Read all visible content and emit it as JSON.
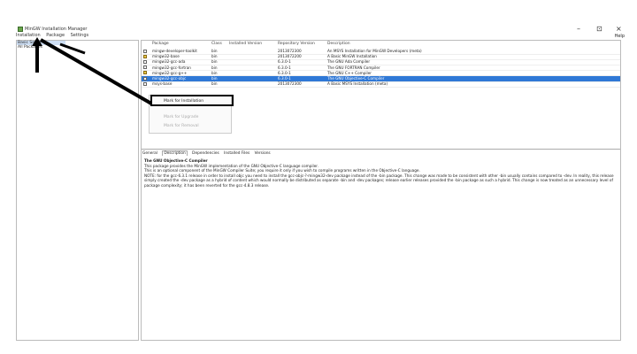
{
  "window": {
    "title": "MinGW Installation Manager",
    "minimize": "–",
    "restore": "⊡",
    "close": "×"
  },
  "menu": {
    "installation": "Installation",
    "package": "Package",
    "settings": "Settings",
    "help": "Help"
  },
  "left_pane": {
    "items": [
      "Basic Setup",
      "All Packages"
    ]
  },
  "grid": {
    "headers": [
      "Package",
      "Class",
      "Installed Version",
      "Repository Version",
      "Description"
    ],
    "rows": [
      {
        "package": "mingw-developer-toolkit",
        "class": "bin",
        "installed": "",
        "repo": "2013072300",
        "desc": "An MSYS Installation for MinGW Developers (meta)",
        "installed_flag": false,
        "selected": false
      },
      {
        "package": "mingw32-base",
        "class": "bin",
        "installed": "",
        "repo": "2013072200",
        "desc": "A Basic MinGW Installation",
        "installed_flag": true,
        "selected": false
      },
      {
        "package": "mingw32-gcc-ada",
        "class": "bin",
        "installed": "",
        "repo": "6.3.0-1",
        "desc": "The GNU Ada Compiler",
        "installed_flag": false,
        "selected": false
      },
      {
        "package": "mingw32-gcc-fortran",
        "class": "bin",
        "installed": "",
        "repo": "6.3.0-1",
        "desc": "The GNU FORTRAN Compiler",
        "installed_flag": false,
        "selected": false
      },
      {
        "package": "mingw32-gcc-g++",
        "class": "bin",
        "installed": "",
        "repo": "6.3.0-1",
        "desc": "The GNU C++ Compiler",
        "installed_flag": true,
        "selected": false
      },
      {
        "package": "mingw32-gcc-objc",
        "class": "bin",
        "installed": "",
        "repo": "6.3.0-1",
        "desc": "The GNU Objective-C Compiler",
        "installed_flag": false,
        "selected": true
      },
      {
        "package": "msys-base",
        "class": "bin",
        "installed": "",
        "repo": "2013072300",
        "desc": "A Basic MSYS Installation (meta)",
        "installed_flag": false,
        "selected": false
      }
    ]
  },
  "context_menu": {
    "mark_install": "Mark for Installation",
    "mark_upgrade": "Mark for Upgrade",
    "mark_removal": "Mark for Removal"
  },
  "tabs": [
    "General",
    "Description",
    "Dependencies",
    "Installed Files",
    "Versions"
  ],
  "description": {
    "heading": "The GNU Objective-C Compiler",
    "line1": "This package provides the MinGW implementation of the GNU Objective-C language compiler.",
    "line2": "This is an optional component of the MinGW Compiler Suite; you require it only if you wish to compile programs written in the Objective-C language.",
    "note": "NOTE: for the gcc-6.3.1 release in order to install objc you need to install the gcc-objc-?-mingw32-dev package instead of the -bin package. This change was made to be consistent with other -bin usually contains compared to -dev. In reality, this release simply created the -dev package as a hybrid of content which would normally be distributed as separate -bin and -dev packages; release earlier releases provided the -bin package as such a hybrid. This change is now treated as an unnecessary level of package complexity; it has been reverted for the gcc-4.8.3 release."
  }
}
